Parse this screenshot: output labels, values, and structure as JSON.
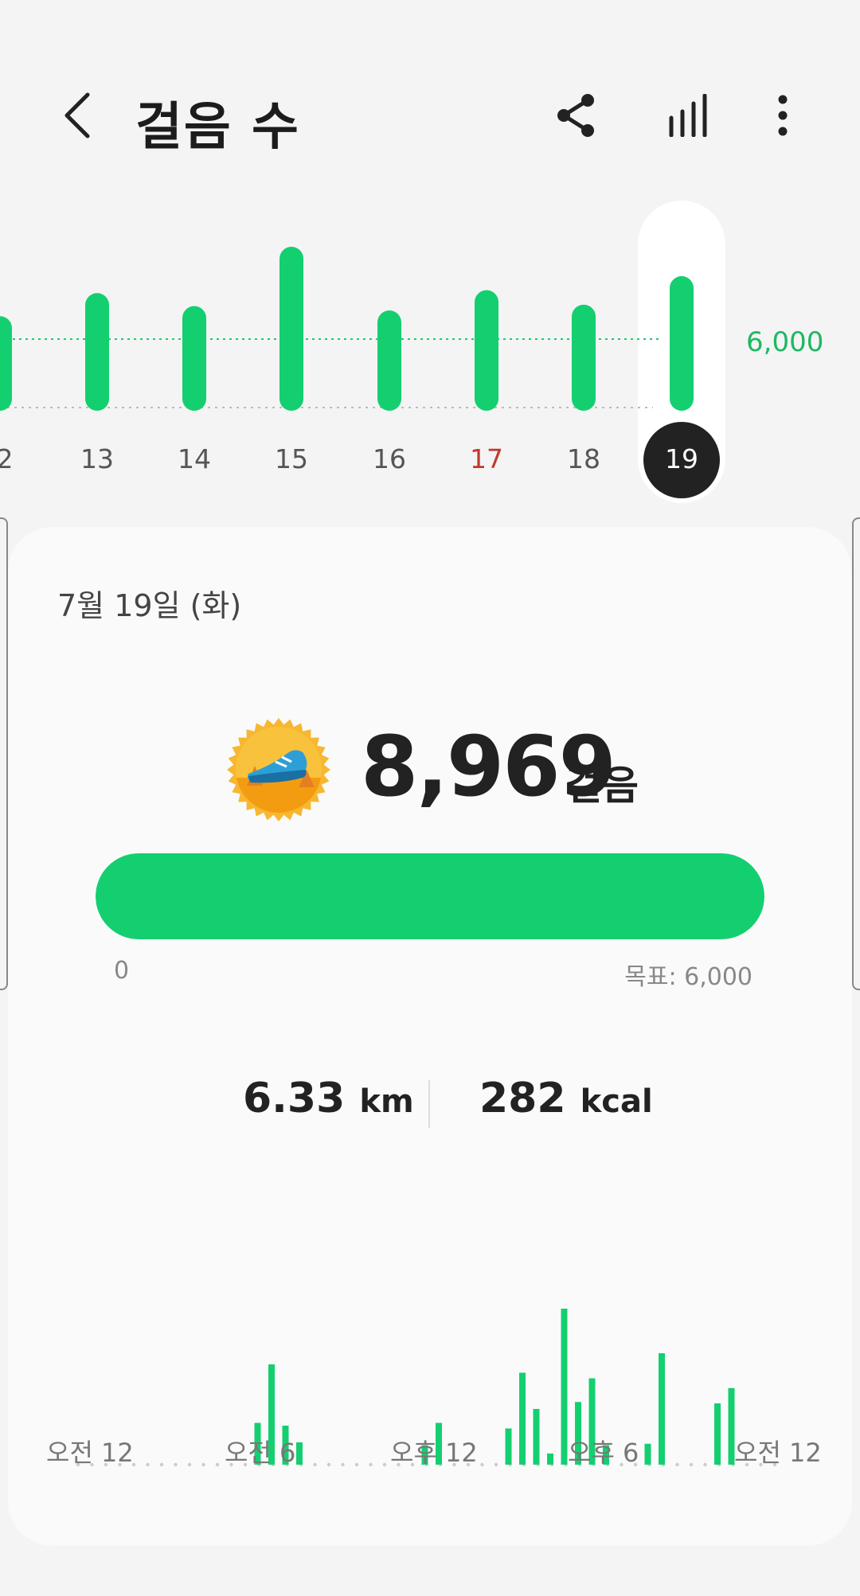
{
  "header": {
    "title": "걸음 수",
    "icons": [
      "back-icon",
      "share-icon",
      "bar-chart-icon",
      "more-vert-icon"
    ]
  },
  "week_chart": {
    "goal_label": "6,000",
    "days": [
      {
        "label": "2",
        "steps": 6200
      },
      {
        "label": "13",
        "steps": 7800
      },
      {
        "label": "14",
        "steps": 6900
      },
      {
        "label": "15",
        "steps": 11000
      },
      {
        "label": "16",
        "steps": 6600
      },
      {
        "label": "17",
        "steps": 8000,
        "highlight": "red"
      },
      {
        "label": "18",
        "steps": 7000
      },
      {
        "label": "19",
        "steps": 8969,
        "selected": true
      }
    ]
  },
  "summary": {
    "date": "7월 19일 (화)",
    "steps": "8,969",
    "steps_unit": "걸음",
    "progress_fraction": 1.0,
    "progress_min": "0",
    "progress_goal": "목표: 6,000",
    "distance_value": "6.33",
    "distance_unit": "km",
    "calories_value": "282",
    "calories_unit": "kcal"
  },
  "hourly_chart": {
    "x_labels": [
      "오전 12",
      "오전 6",
      "오후 12",
      "오후 6",
      "오전 12"
    ],
    "bins": [
      0,
      0,
      0,
      0,
      0,
      0,
      0,
      0,
      0,
      0,
      0,
      0,
      0,
      0,
      0,
      0,
      0,
      0,
      0,
      0,
      0,
      0,
      0,
      0,
      0,
      0,
      30,
      70,
      0,
      0,
      0,
      0,
      0,
      0,
      0,
      0,
      0,
      0,
      0,
      0,
      0,
      0,
      0,
      0,
      0,
      0,
      0,
      0,
      0,
      0,
      0,
      0,
      0,
      0,
      0,
      0,
      0,
      0,
      0,
      0,
      0,
      0,
      0,
      0,
      0,
      0,
      0,
      0,
      0,
      0,
      15,
      30,
      0,
      0,
      0,
      0,
      0,
      0,
      0,
      0,
      0,
      0,
      0,
      0,
      0,
      0,
      0,
      0,
      0,
      0,
      0,
      0,
      0,
      0,
      0,
      0
    ],
    "bars": [
      {
        "bin": 13,
        "value": 30
      },
      {
        "bin": 14,
        "value": 72
      },
      {
        "bin": 15,
        "value": 28
      },
      {
        "bin": 16,
        "value": 16
      },
      {
        "bin": 25,
        "value": 14
      },
      {
        "bin": 26,
        "value": 30
      },
      {
        "bin": 31,
        "value": 26
      },
      {
        "bin": 32,
        "value": 66
      },
      {
        "bin": 33,
        "value": 40
      },
      {
        "bin": 34,
        "value": 8
      },
      {
        "bin": 35,
        "value": 112
      },
      {
        "bin": 36,
        "value": 45
      },
      {
        "bin": 37,
        "value": 62
      },
      {
        "bin": 38,
        "value": 14
      },
      {
        "bin": 41,
        "value": 15
      },
      {
        "bin": 42,
        "value": 80
      },
      {
        "bin": 46,
        "value": 44
      },
      {
        "bin": 47,
        "value": 55
      }
    ],
    "total_bins": 52
  },
  "colors": {
    "accent": "#14cf70",
    "goal_text": "#1db862",
    "sunday": "#c0392b",
    "selected_circle": "#222222"
  }
}
